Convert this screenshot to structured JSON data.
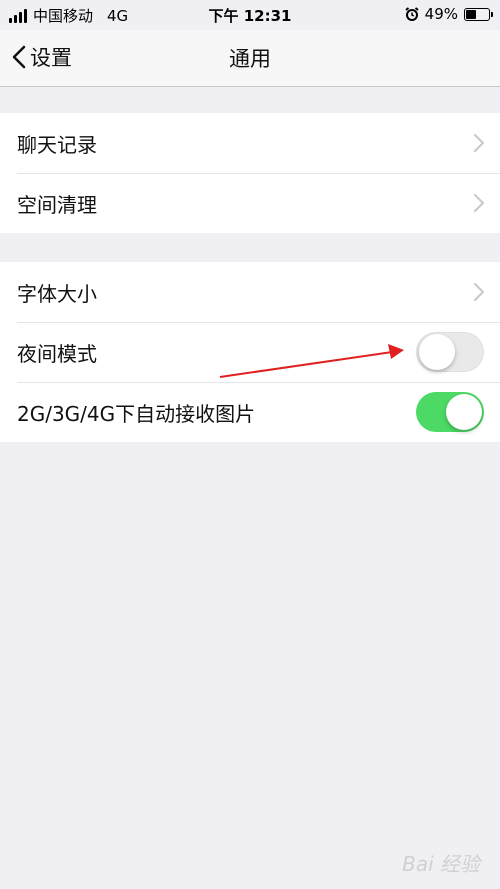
{
  "status_bar": {
    "carrier": "中国移动",
    "network": "4G",
    "time": "下午 12:31",
    "battery_percent": "49%",
    "battery_level": 0.49
  },
  "nav": {
    "back_label": "设置",
    "title": "通用"
  },
  "groups": [
    {
      "items": [
        {
          "label": "聊天记录",
          "accessory": "chevron"
        },
        {
          "label": "空间清理",
          "accessory": "chevron"
        }
      ]
    },
    {
      "items": [
        {
          "label": "字体大小",
          "accessory": "chevron"
        },
        {
          "label": "夜间模式",
          "accessory": "toggle",
          "on": false
        },
        {
          "label": "2G/3G/4G下自动接收图片",
          "accessory": "toggle",
          "on": true
        }
      ]
    }
  ],
  "colors": {
    "toggle_on": "#4cd964",
    "annotation_arrow": "#e02020"
  },
  "icons": {
    "back": "chevron-left-icon",
    "row_accessory": "chevron-right-icon",
    "alarm": "alarm-icon"
  },
  "watermark": "Bai 经验"
}
